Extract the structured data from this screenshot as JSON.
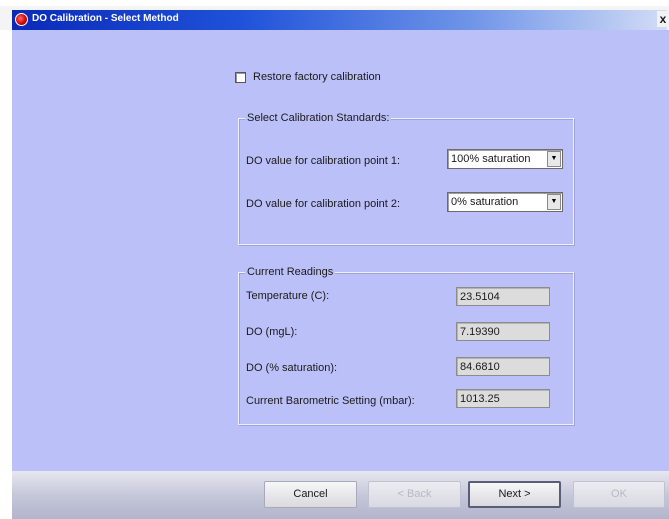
{
  "window": {
    "title": "DO Calibration - Select Method",
    "close_glyph": "x"
  },
  "restore": {
    "label": "Restore factory calibration",
    "checked": false
  },
  "standards": {
    "title": "Select Calibration Standards:",
    "point1": {
      "label": "DO value for calibration point 1:",
      "value": "100% saturation"
    },
    "point2": {
      "label": "DO value for calibration point 2:",
      "value": "0% saturation"
    }
  },
  "readings": {
    "title": "Current Readings",
    "rows": [
      {
        "label": "Temperature (C):",
        "value": "23.5104"
      },
      {
        "label": "DO (mgL):",
        "value": "7.19390"
      },
      {
        "label": "DO (% saturation):",
        "value": "84.6810"
      },
      {
        "label": "Current Barometric Setting (mbar):",
        "value": "1013.25"
      }
    ]
  },
  "buttons": {
    "cancel": "Cancel",
    "back": "< Back",
    "next": "Next >",
    "ok": "OK"
  },
  "icons": {
    "app": "app-icon",
    "close": "close-icon",
    "dropdown": "chevron-down-icon"
  },
  "colors": {
    "title_blue": "#0a2ab8",
    "client_bg": "#bcc0f8"
  }
}
